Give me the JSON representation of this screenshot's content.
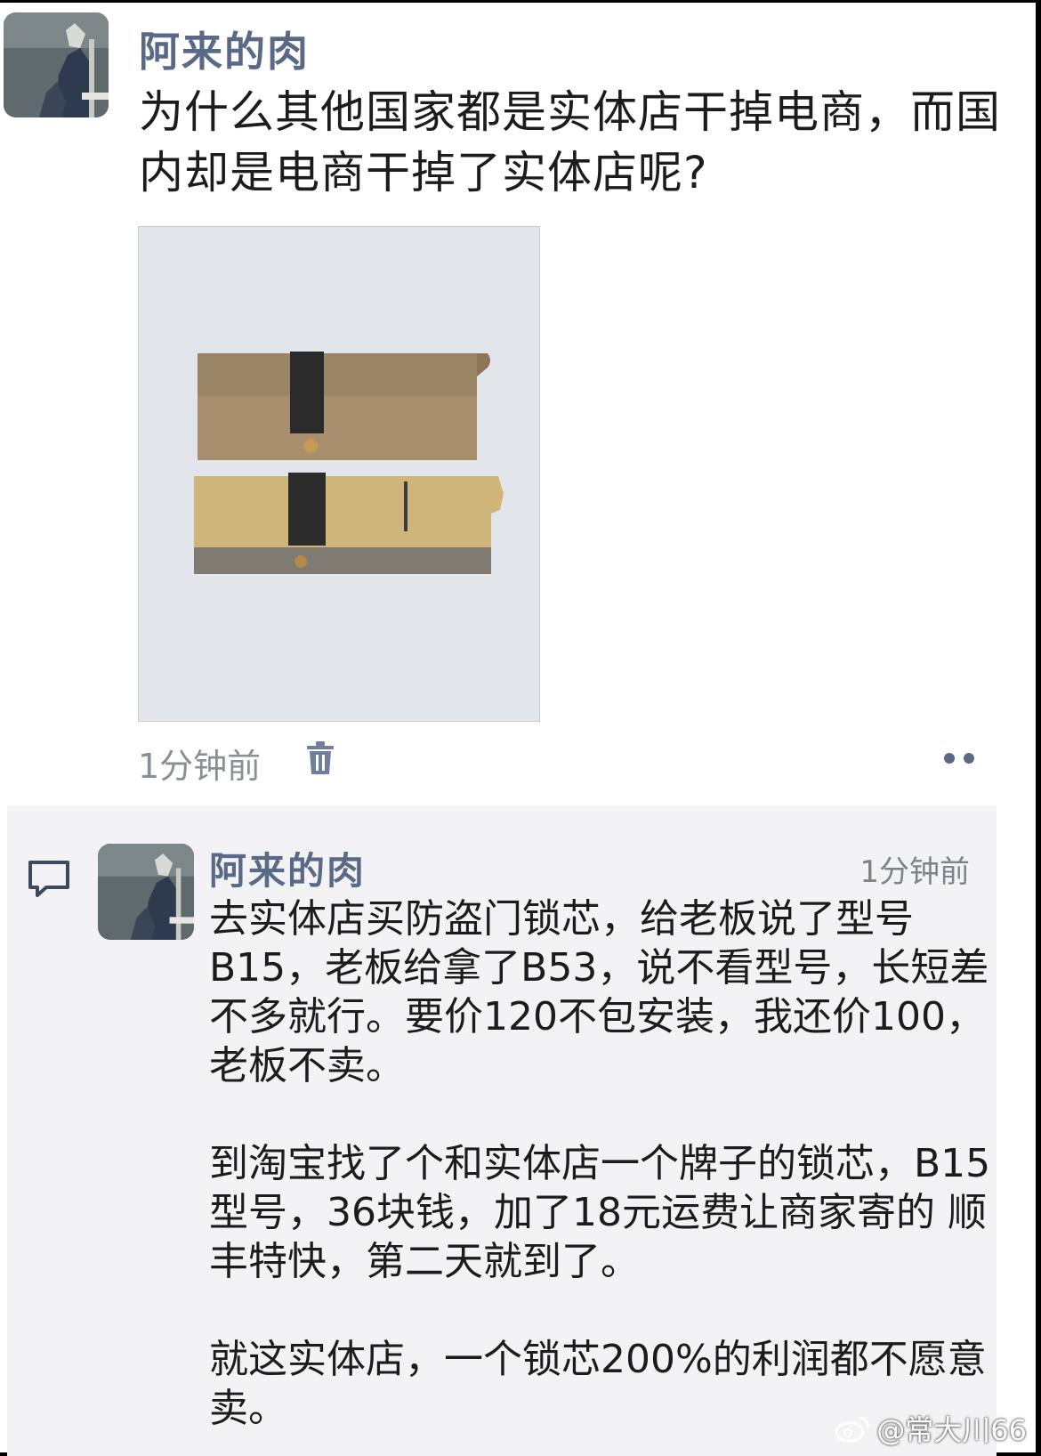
{
  "post": {
    "author": "阿来的肉",
    "text": "为什么其他国家都是实体店干掉电商，而国内却是电商干掉了实体店呢?",
    "time": "1分钟前"
  },
  "comment": {
    "author": "阿来的肉",
    "time": "1分钟前",
    "paragraphs": [
      "去实体店买防盗门锁芯，给老板说了型号B15，老板给拿了B53，说不看型号，长短差不多就行。要价120不包安装，我还价100，老板不卖。",
      "到淘宝找了个和实体店一个牌子的锁芯，B15型号，36块钱，加了18元运费让商家寄的 顺丰特快，第二天就到了。",
      "就这实体店，一个锁芯200%的利润都不愿意卖。"
    ]
  },
  "watermark": "@常大川66",
  "icons": {
    "trash": "trash-icon",
    "more": "more-dots-icon",
    "comment": "comment-bubble-icon",
    "weibo": "weibo-logo-icon"
  }
}
